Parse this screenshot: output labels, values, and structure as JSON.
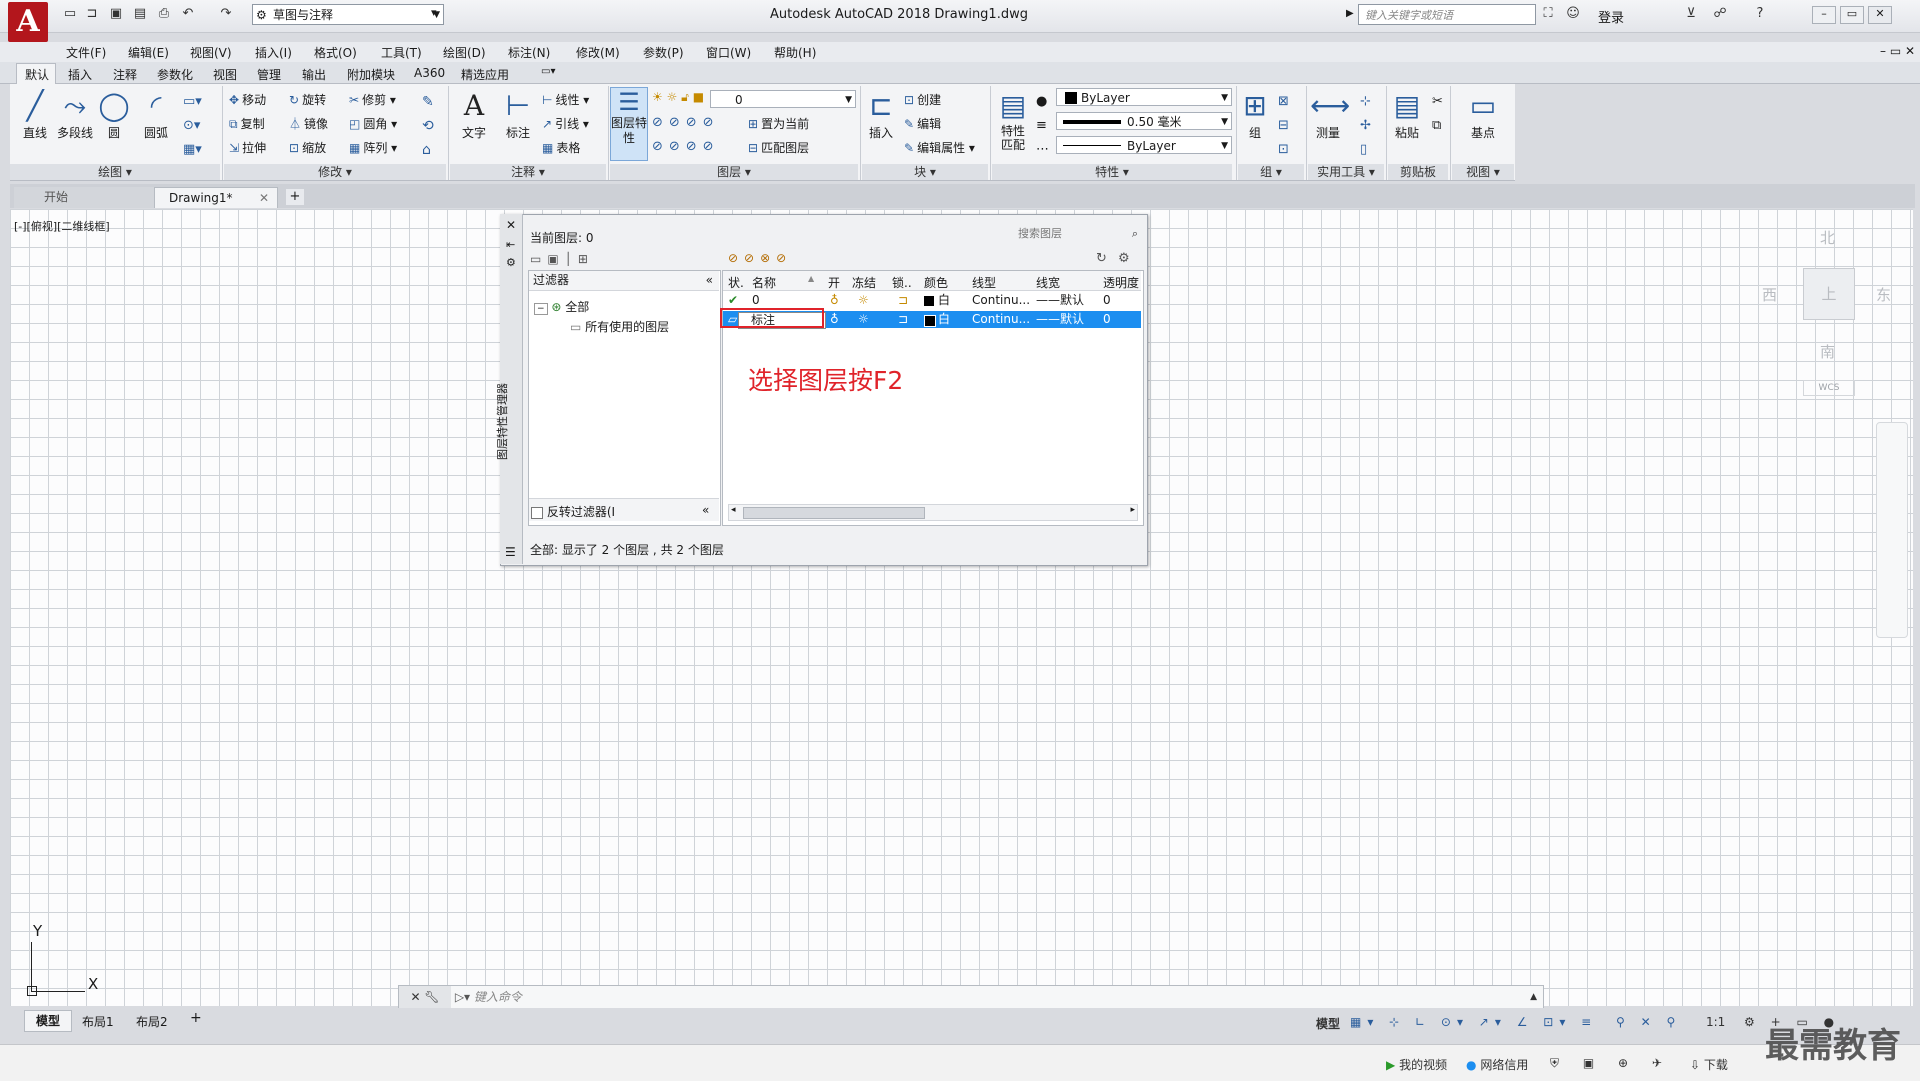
{
  "app": {
    "logo_letter": "A",
    "title": "Autodesk AutoCAD 2018    Drawing1.dwg",
    "workspace": "草图与注释",
    "search_placeholder": "键入关键字或短语",
    "login": "登录"
  },
  "menu": [
    "文件(F)",
    "编辑(E)",
    "视图(V)",
    "插入(I)",
    "格式(O)",
    "工具(T)",
    "绘图(D)",
    "标注(N)",
    "修改(M)",
    "参数(P)",
    "窗口(W)",
    "帮助(H)"
  ],
  "ribbon_tabs": [
    "默认",
    "插入",
    "注释",
    "参数化",
    "视图",
    "管理",
    "输出",
    "附加模块",
    "A360",
    "精选应用"
  ],
  "ribbon": {
    "draw": {
      "title": "绘图",
      "line": "直线",
      "polyline": "多段线",
      "circle": "圆",
      "arc": "圆弧"
    },
    "modify": {
      "title": "修改",
      "move": "移动",
      "rotate": "旋转",
      "trim": "修剪",
      "copy": "复制",
      "mirror": "镜像",
      "fillet": "圆角",
      "stretch": "拉伸",
      "scale": "缩放",
      "array": "阵列"
    },
    "annotation": {
      "title": "注释",
      "text": "文字",
      "dimension": "标注",
      "linear": "线性",
      "leader": "引线",
      "table": "表格"
    },
    "layers": {
      "title": "图层",
      "properties": "图层特性",
      "current_layer": "0",
      "set_current": "置为当前",
      "match_layer": "匹配图层"
    },
    "block": {
      "title": "块",
      "insert": "插入",
      "create": "创建",
      "edit": "编辑",
      "edit_attributes": "编辑属性"
    },
    "properties": {
      "title": "特性",
      "match": "特性匹配",
      "color": "ByLayer",
      "lineweight": "0.50 毫米",
      "linetype": "ByLayer"
    },
    "groups": {
      "title": "组",
      "group": "组"
    },
    "utilities": {
      "title": "实用工具",
      "measure": "测量"
    },
    "clipboard": {
      "title": "剪贴板",
      "paste": "粘贴"
    },
    "view": {
      "title": "视图",
      "base": "基点"
    }
  },
  "doc_tabs": {
    "start": "开始",
    "drawing": "Drawing1*"
  },
  "viewport_label": "[-][俯视][二维线框]",
  "viewcube": {
    "north": "北",
    "south": "南",
    "east": "东",
    "west": "西",
    "face": "上",
    "wcs": "WCS"
  },
  "layer_manager": {
    "side_title": "图层特性管理器",
    "current_layer": "当前图层: 0",
    "search_placeholder": "搜索图层",
    "filters_header": "过滤器",
    "filter_all": "全部",
    "filter_used": "所有使用的图层",
    "invert_filter": "反转过滤器(I",
    "columns": [
      "状.",
      "名称",
      "开",
      "冻结",
      "锁..",
      "颜色",
      "线型",
      "线宽",
      "透明度"
    ],
    "rows": [
      {
        "name": "0",
        "color": "白",
        "linetype": "Continu...",
        "lineweight": "默认",
        "transparency": "0"
      },
      {
        "name": "标注",
        "color": "白",
        "linetype": "Continu...",
        "lineweight": "默认",
        "transparency": "0"
      }
    ],
    "status": "全部: 显示了 2 个图层 , 共 2 个图层"
  },
  "annotation": "选择图层按F2",
  "ucs": {
    "y": "Y",
    "x": "X"
  },
  "command_placeholder": "键入命令",
  "layout_tabs": [
    "模型",
    "布局1",
    "布局2"
  ],
  "status": {
    "model": "模型",
    "scale": "1:1"
  },
  "taskbar": {
    "my_video": "我的视频",
    "network": "网络信用",
    "download": "下载"
  },
  "watermark": "最需教育"
}
